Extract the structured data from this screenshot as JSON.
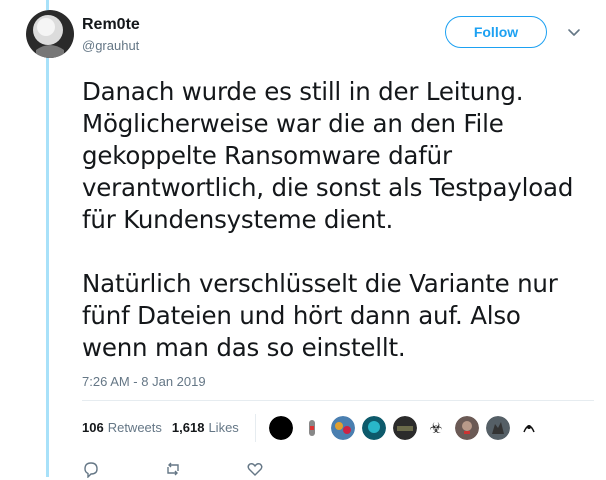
{
  "user": {
    "display_name": "Rem0te",
    "screen_name": "@grauhut"
  },
  "follow_label": "Follow",
  "tweet": {
    "text": "Danach wurde es still in der Leitung.\nMöglicherweise war die an den File\ngekoppelte Ransomware dafür\nverantwortlich, die sonst als Testpayload\nfür Kundensysteme dient.\n\nNatürlich verschlüsselt die Variante nur\nfünf Dateien und hört dann auf. Also\nwenn man das so einstellt.",
    "timestamp": "7:26 AM - 8 Jan 2019"
  },
  "stats": {
    "retweets_count": "106",
    "retweets_label": "Retweets",
    "likes_count": "1,618",
    "likes_label": "Likes"
  },
  "likers": [
    {
      "name": "black-circle-avatar",
      "color": "#000000"
    },
    {
      "name": "figure-avatar",
      "color": "#ffffff"
    },
    {
      "name": "colorful-avatar",
      "color": "#4a7fb0"
    },
    {
      "name": "cyan-avatar",
      "color": "#0d5a6b"
    },
    {
      "name": "dark-avatar",
      "color": "#2b2b2b"
    },
    {
      "name": "biohazard-avatar",
      "color": "#ffffff"
    },
    {
      "name": "face-avatar",
      "color": "#6b5a55"
    },
    {
      "name": "cat-avatar",
      "color": "#555f66"
    },
    {
      "name": "sketch-avatar",
      "color": "#ffffff"
    }
  ],
  "colors": {
    "accent": "#1da1f2",
    "thread_line": "#a8e1f9",
    "muted": "#657786"
  }
}
